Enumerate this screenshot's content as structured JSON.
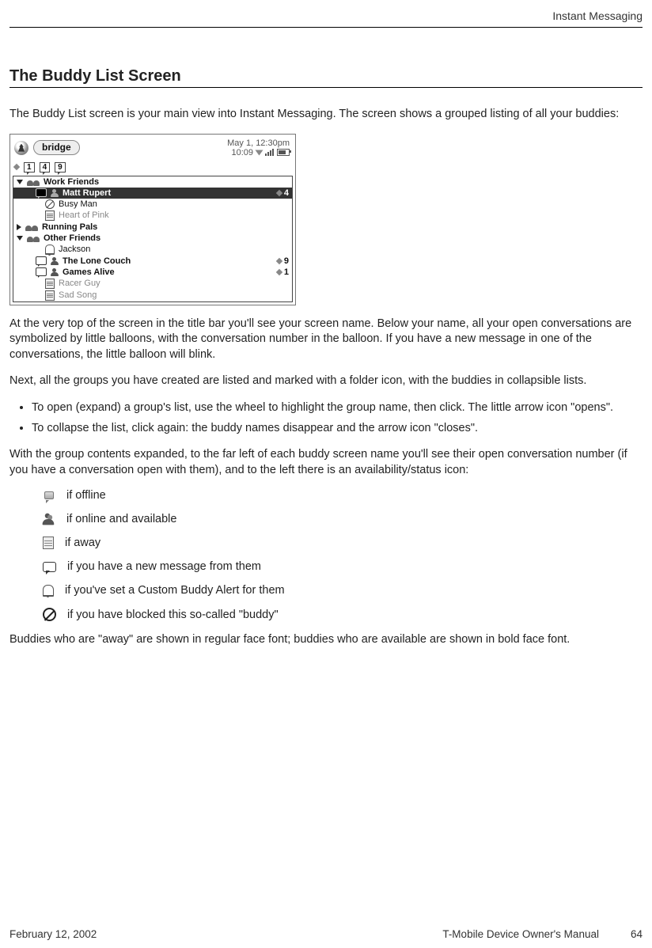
{
  "header": {
    "chapter_label": "Instant Messaging"
  },
  "section": {
    "title": "The Buddy List Screen",
    "intro": "The Buddy List screen is your main view into Instant Messaging. The screen shows a grouped listing of all your buddies:",
    "para_after_shot_1": "At the very top of the screen in the title bar you'll see your screen name. Below your name, all your open conversations are symbolized by little balloons, with the conversation number in the balloon. If you have a new message in one of the conversations, the little balloon will blink.",
    "para_after_shot_2": "Next, all the groups you have created are listed and marked with a folder icon, with the buddies in collapsible lists.",
    "bullets": [
      "To open (expand) a group's list, use the wheel to highlight the group name, then click. The little arrow icon \"opens\".",
      "To collapse the list, click again: the buddy names disappear and the arrow icon \"closes\"."
    ],
    "para_status_intro": "With the group contents expanded, to the far left of each buddy screen name you'll see their open conversation number (if you have a conversation open with them), and to the left there is an availability/status icon:",
    "legend": [
      {
        "icon": "offline",
        "label": "if offline"
      },
      {
        "icon": "online",
        "label": "if online and available"
      },
      {
        "icon": "away",
        "label": "if away"
      },
      {
        "icon": "newmsg",
        "label": "if you have a new message from them"
      },
      {
        "icon": "alert",
        "label": "if you've set a Custom Buddy Alert for them"
      },
      {
        "icon": "blocked",
        "label": "if you have blocked this so-called \"buddy\""
      }
    ],
    "para_font_note": "Buddies who are \"away\" are shown in regular face font; buddies who are available are shown in bold face font."
  },
  "device_shot": {
    "screen_name": "bridge",
    "datetime": "May 1, 12:30pm",
    "clock": "10:09",
    "open_convos": [
      "1",
      "4",
      "9"
    ],
    "groups": [
      {
        "name": "Work Friends",
        "expanded": true,
        "buddies": [
          {
            "name": "Matt Rupert",
            "status": "online",
            "msg": true,
            "selected": true,
            "count": "4"
          },
          {
            "name": "Busy Man",
            "status": "blocked"
          },
          {
            "name": "Heart of Pink",
            "status": "offline",
            "grey": true
          }
        ]
      },
      {
        "name": "Running Pals",
        "expanded": false,
        "buddies": []
      },
      {
        "name": "Other Friends",
        "expanded": true,
        "buddies": [
          {
            "name": "Jackson",
            "status": "alert"
          },
          {
            "name": "The Lone Couch",
            "status": "online",
            "msg": true,
            "bold": true,
            "count": "9"
          },
          {
            "name": "Games Alive",
            "status": "online",
            "msg": true,
            "bold": true,
            "count": "1"
          },
          {
            "name": "Racer Guy",
            "status": "offline",
            "grey": true
          },
          {
            "name": "Sad Song",
            "status": "offline",
            "grey": true
          }
        ]
      }
    ]
  },
  "footer": {
    "date": "February 12, 2002",
    "doc_title": "T-Mobile Device Owner's Manual",
    "page": "64"
  }
}
